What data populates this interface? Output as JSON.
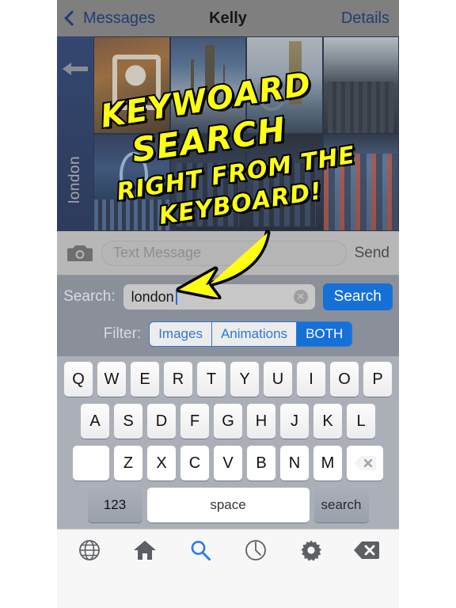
{
  "navbar": {
    "back_label": "Messages",
    "title": "Kelly",
    "details_label": "Details",
    "back_icon": "chevron-left-icon"
  },
  "photo_panel": {
    "rail_label": "london",
    "rail_icon": "arrow-left-icon",
    "photos": [
      {
        "caption": "tower-bridge-collage"
      },
      {
        "caption": "houses-of-parliament"
      },
      {
        "caption": "big-ben-london-eye"
      },
      {
        "caption": "city-aerial-view"
      },
      {
        "caption": "london-eye-night"
      },
      {
        "caption": "tower-bridge-night"
      },
      {
        "caption": "thames-skyline"
      },
      {
        "caption": "street-lights-night"
      }
    ]
  },
  "promo": {
    "line1": "KEYWOARD",
    "line2": "SEARCH",
    "line3": "RIGHT FROM THE",
    "line4": "KEYBOARD!",
    "arrow_icon": "curved-arrow-icon",
    "color": "#ffff14"
  },
  "message_bar": {
    "camera_icon": "camera-icon",
    "placeholder": "Text Message",
    "value": "",
    "send_label": "Send"
  },
  "search_panel": {
    "search_label": "Search:",
    "search_value": "london",
    "search_placeholder": "",
    "clear_icon": "clear-circle-icon",
    "search_button": "Search",
    "filter_label": "Filter:",
    "filter_options": [
      "Images",
      "Animations",
      "BOTH"
    ],
    "filter_selected": "BOTH",
    "accent_color": "#1570d8"
  },
  "keyboard": {
    "row1": [
      "Q",
      "W",
      "E",
      "R",
      "T",
      "Y",
      "U",
      "I",
      "O",
      "P"
    ],
    "row2": [
      "A",
      "S",
      "D",
      "F",
      "G",
      "H",
      "J",
      "K",
      "L"
    ],
    "row3": [
      "Z",
      "X",
      "C",
      "V",
      "B",
      "N",
      "M"
    ],
    "shift_icon": "shift-up-icon",
    "backspace_icon": "backspace-icon",
    "numbers_label": "123",
    "space_label": "space",
    "search_key_label": "search"
  },
  "toolbar": {
    "items": [
      {
        "name": "globe-icon",
        "active": false
      },
      {
        "name": "home-icon",
        "active": false
      },
      {
        "name": "search-icon",
        "active": true
      },
      {
        "name": "clock-icon",
        "active": false
      },
      {
        "name": "gear-icon",
        "active": false
      },
      {
        "name": "delete-icon",
        "active": false
      }
    ],
    "active_color": "#2a7bea"
  }
}
